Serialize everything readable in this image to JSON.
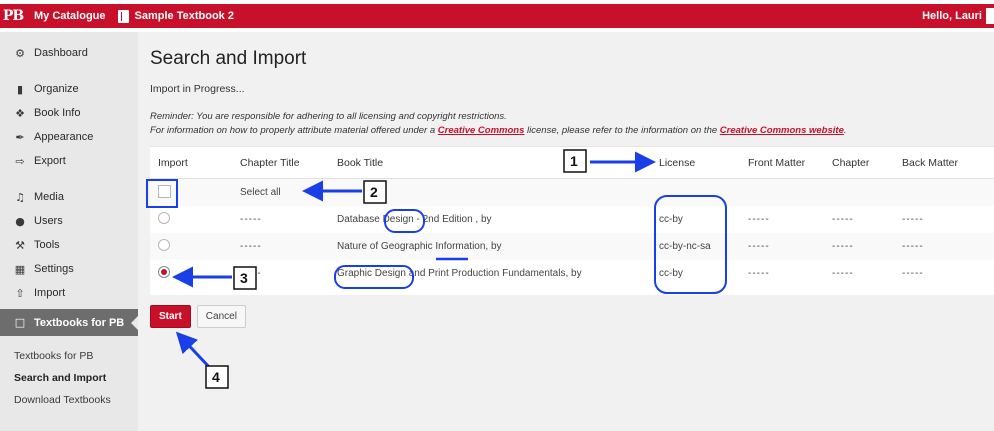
{
  "admin_bar": {
    "logo": "PB",
    "catalogue": "My Catalogue",
    "book": "Sample Textbook 2",
    "greeting": "Hello, Lauri"
  },
  "sidebar": {
    "items": [
      {
        "label": "Dashboard",
        "icon": "dashboard-icon"
      },
      {
        "label": "Organize",
        "icon": "book-icon"
      },
      {
        "label": "Book Info",
        "icon": "info-icon"
      },
      {
        "label": "Appearance",
        "icon": "brush-icon"
      },
      {
        "label": "Export",
        "icon": "export-icon"
      },
      {
        "label": "Media",
        "icon": "media-icon"
      },
      {
        "label": "Users",
        "icon": "users-icon"
      },
      {
        "label": "Tools",
        "icon": "wrench-icon"
      },
      {
        "label": "Settings",
        "icon": "settings-icon"
      },
      {
        "label": "Import",
        "icon": "import-icon"
      },
      {
        "label": "Textbooks for PB",
        "icon": "textbooks-icon"
      }
    ],
    "submenu": [
      "Textbooks for PB",
      "Search and Import",
      "Download Textbooks"
    ]
  },
  "main": {
    "title": "Search and Import",
    "status": "Import in Progress...",
    "reminder_line1": "Reminder: You are responsible for adhering to all licensing and copyright restrictions.",
    "reminder_line2_pre": "For information on how to properly attribute material offered under a ",
    "reminder_link1": "Creative Commons",
    "reminder_line2_mid": " license, please refer to the information on the ",
    "reminder_link2": "Creative Commons website",
    "reminder_line2_post": "."
  },
  "table": {
    "headers": [
      "Import",
      "Chapter Title",
      "Book Title",
      "License",
      "Front Matter",
      "Chapter",
      "Back Matter"
    ],
    "select_all": "Select all",
    "rows": [
      {
        "chapter": "-----",
        "book": "Database Design - 2nd Edition , by",
        "license": "cc-by",
        "front": "-----",
        "chapter_col": "-----",
        "back": "-----",
        "selected": false
      },
      {
        "chapter": "-----",
        "book": "Nature of Geographic Information, by",
        "license": "cc-by-nc-sa",
        "front": "-----",
        "chapter_col": "-----",
        "back": "-----",
        "selected": false
      },
      {
        "chapter": "-----",
        "book": "Graphic Design and Print Production Fundamentals, by",
        "license": "cc-by",
        "front": "-----",
        "chapter_col": "-----",
        "back": "-----",
        "selected": true
      }
    ]
  },
  "buttons": {
    "start": "Start",
    "cancel": "Cancel"
  },
  "annotations": [
    "1",
    "2",
    "3",
    "4"
  ],
  "colors": {
    "brand": "#c9102a",
    "annotation": "#1a3fe6",
    "sidebar_active": "#6d6d6d"
  }
}
